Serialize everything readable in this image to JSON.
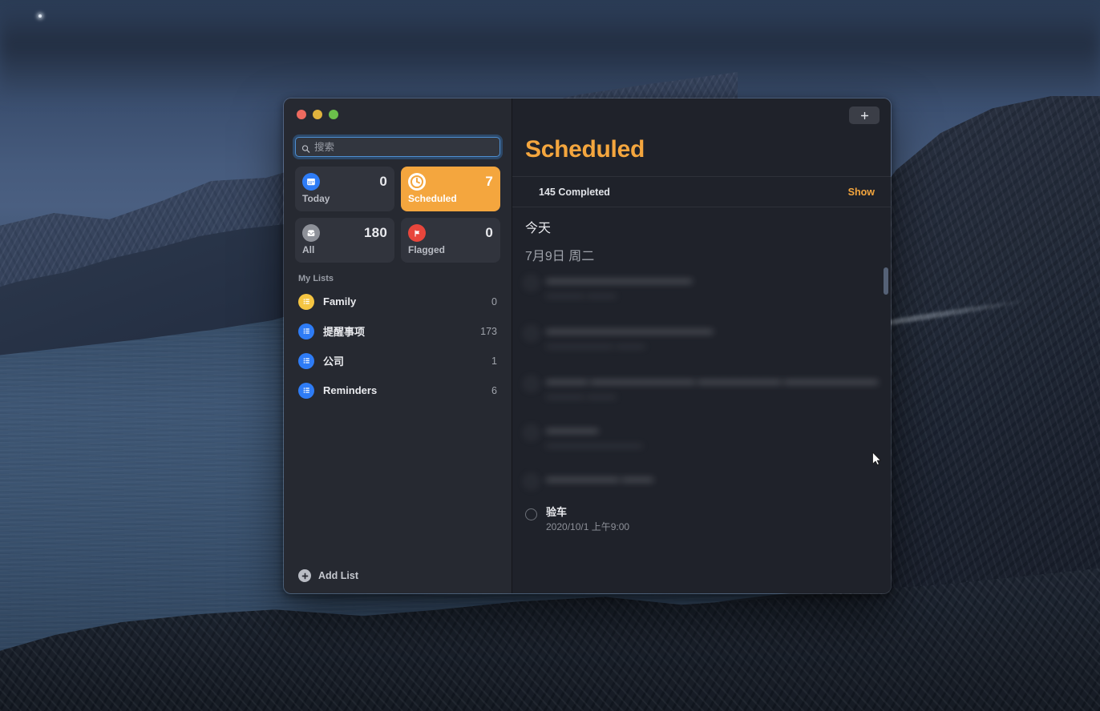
{
  "window": {
    "traffic_lights": [
      {
        "name": "close",
        "color": "#ee6a5f"
      },
      {
        "name": "minimize",
        "color": "#e0b33d"
      },
      {
        "name": "zoom",
        "color": "#6bbf4b"
      }
    ]
  },
  "sidebar": {
    "search": {
      "placeholder": "搜索",
      "value": "",
      "icon": "search-icon"
    },
    "smart_lists": [
      {
        "label": "Today",
        "count": "0",
        "icon": "calendar-icon",
        "accent": "#2e7cf6",
        "selected": false
      },
      {
        "label": "Scheduled",
        "count": "7",
        "icon": "clock-icon",
        "accent": "#ffffff",
        "selected": true
      },
      {
        "label": "All",
        "count": "180",
        "icon": "inbox-icon",
        "accent": "#8e9199",
        "selected": false
      },
      {
        "label": "Flagged",
        "count": "0",
        "icon": "flag-icon",
        "accent": "#e8463c",
        "selected": false
      }
    ],
    "my_lists_title": "My Lists",
    "lists": [
      {
        "label": "Family",
        "count": "0",
        "color": "#f5c542",
        "icon": "list-icon"
      },
      {
        "label": "提醒事项",
        "count": "173",
        "color": "#2e7cf6",
        "icon": "list-icon"
      },
      {
        "label": "公司",
        "count": "1",
        "color": "#2e7cf6",
        "icon": "list-icon"
      },
      {
        "label": "Reminders",
        "count": "6",
        "color": "#2e7cf6",
        "icon": "list-icon"
      }
    ],
    "add_list": {
      "label": "Add List",
      "icon": "plus-circle-icon"
    }
  },
  "main": {
    "add_button_icon": "plus-icon",
    "title": "Scheduled",
    "title_color": "#f4a63e",
    "completed_label": "145 Completed",
    "show_label": "Show",
    "groups": [
      {
        "today_label": "今天",
        "date_label": "7月9日 周二"
      }
    ],
    "reminders": [
      {
        "title": "——————————————",
        "sub": "———— ———",
        "blurred": true
      },
      {
        "title": "————————————————",
        "sub": "——————— ———",
        "blurred": true
      },
      {
        "title": "———— ——————————  ————————  —————————",
        "sub": "———— ———",
        "blurred": true
      },
      {
        "title": "—————",
        "sub": "——————————",
        "blurred": true
      },
      {
        "title": "——————— ———",
        "sub": "",
        "blurred": true
      },
      {
        "title": "验车",
        "sub": "2020/10/1 上午9:00",
        "blurred": false
      }
    ]
  }
}
